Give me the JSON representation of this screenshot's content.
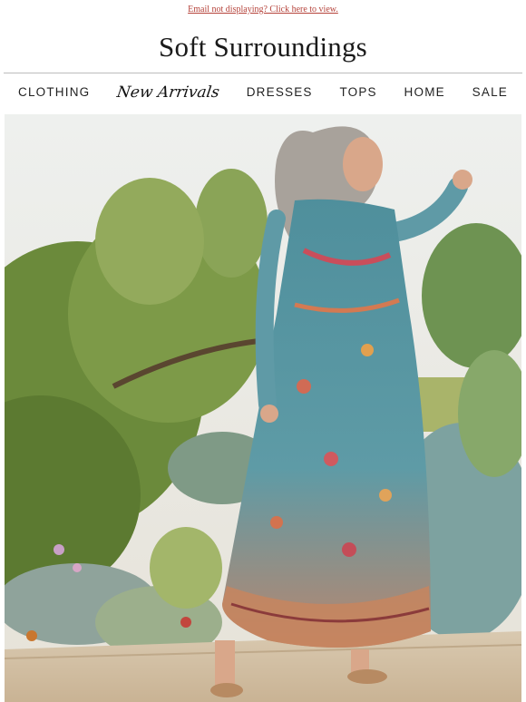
{
  "preheader": {
    "link_text": "Email not displaying? Click here to view."
  },
  "brand": {
    "name": "Soft Surroundings"
  },
  "nav": {
    "items": [
      {
        "label": "CLOTHING"
      },
      {
        "label": "New Arrivals"
      },
      {
        "label": "DRESSES"
      },
      {
        "label": "TOPS"
      },
      {
        "label": "HOME"
      },
      {
        "label": "SALE"
      }
    ]
  },
  "hero": {
    "description_icon": "hero-photo-woman-in-maxi-dress",
    "colors": {
      "sky": "#e9ecea",
      "dress": "#5e9aa6",
      "foliage": "#6f8d3e",
      "ground": "#d8c7ad"
    }
  }
}
